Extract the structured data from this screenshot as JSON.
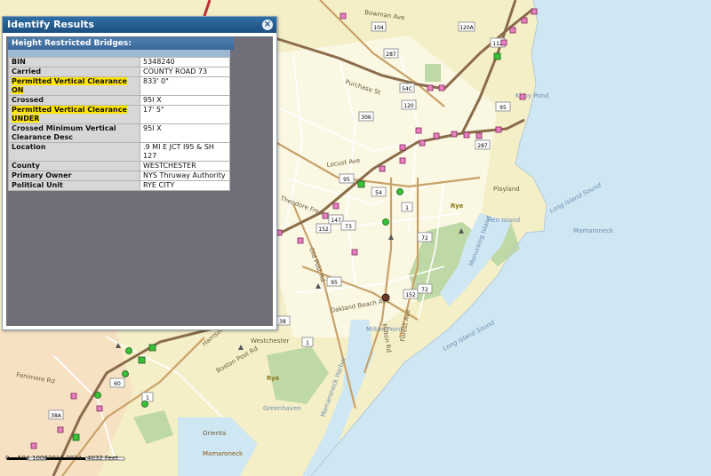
{
  "window": {
    "title": "Identify Results",
    "close_glyph": "×"
  },
  "results": {
    "title": "Height Restricted Bridges:",
    "rows": [
      {
        "key": "BIN",
        "value": "5348240",
        "highlight": false
      },
      {
        "key": "Carried",
        "value": "COUNTY ROAD 73",
        "highlight": false
      },
      {
        "key": "Permitted Vertical Clearance ON",
        "value": "833' 0\"",
        "highlight": true
      },
      {
        "key": "Crossed",
        "value": "95I X",
        "highlight": false
      },
      {
        "key": "Permitted Vertical Clearance UNDER",
        "value": "17' 5\"",
        "highlight": true
      },
      {
        "key": "Crossed Minimum Vertical Clearance Desc",
        "value": "95I X",
        "highlight": false
      },
      {
        "key": "Location",
        "value": ".9 MI E JCT I95 & SH 127",
        "highlight": false
      },
      {
        "key": "County",
        "value": "WESTCHESTER",
        "highlight": false
      },
      {
        "key": "Primary Owner",
        "value": "NYS Thruway Authority",
        "highlight": false
      },
      {
        "key": "Political Unit",
        "value": "RYE CITY",
        "highlight": false
      }
    ]
  },
  "map": {
    "labels": [
      "Purchase St",
      "Locust Ave",
      "Theodore Fremd Ave",
      "Old Post Rd",
      "Oakland Beach Ave",
      "Milton Rd",
      "Forest Ave",
      "Boston Post Rd",
      "Rye",
      "Rye",
      "Long Island Sound",
      "Long Island Sound",
      "Milton Point",
      "Mamaroneck",
      "Mamaroneck",
      "Harrison",
      "Fenimore Rd",
      "Westchester",
      "Greenhaven",
      "Orienta",
      "Manursing Island",
      "Hen Island",
      "Bowman Ave",
      "Mamaroneck Harbor",
      "Playland",
      "Kirby Pond"
    ],
    "shields": [
      "104",
      "287",
      "287",
      "120A",
      "112",
      "95",
      "120",
      "54C",
      "306",
      "95",
      "54",
      "1",
      "147",
      "152",
      "73",
      "72",
      "72",
      "152",
      "1",
      "38",
      "38A",
      "60",
      "1",
      "95"
    ],
    "colors": {
      "water": "#cfe6f3",
      "land": "#f5efc8",
      "town": "#faf7e3",
      "park": "#bfd9a6",
      "highway": "#8a6c4a",
      "bridge": "#e87fbf"
    }
  },
  "scalebar": {
    "ticks": [
      "0",
      "504",
      "1008",
      "2016",
      "3024",
      "4032 Feet"
    ]
  }
}
